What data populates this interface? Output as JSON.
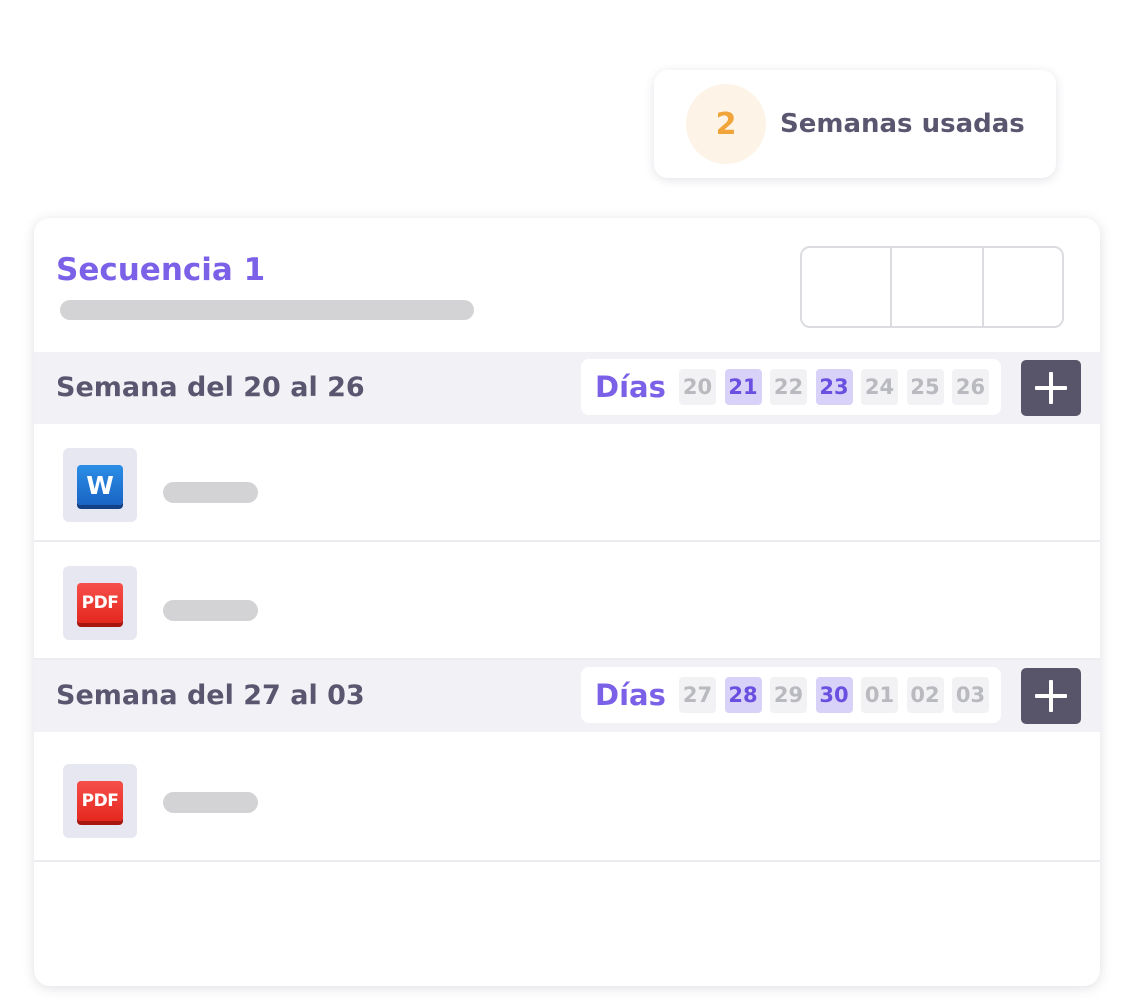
{
  "weeks_badge": {
    "count": "2",
    "label": "Semanas usadas",
    "count_color": "#f0a43a"
  },
  "sequence": {
    "title": "Secuencia 1",
    "accent_color": "#7b61e8"
  },
  "weeks": [
    {
      "title": "Semana del 20 al 26",
      "days_label": "Días",
      "days": [
        {
          "label": "20",
          "active": false
        },
        {
          "label": "21",
          "active": true
        },
        {
          "label": "22",
          "active": false
        },
        {
          "label": "23",
          "active": true
        },
        {
          "label": "24",
          "active": false
        },
        {
          "label": "25",
          "active": false
        },
        {
          "label": "26",
          "active": false
        }
      ],
      "add_icon": "plus-icon",
      "files": [
        {
          "type": "word",
          "icon": "word-file-icon",
          "icon_text": "W"
        },
        {
          "type": "pdf",
          "icon": "pdf-file-icon",
          "icon_text": "PDF"
        }
      ]
    },
    {
      "title": "Semana del 27 al 03",
      "days_label": "Días",
      "days": [
        {
          "label": "27",
          "active": false
        },
        {
          "label": "28",
          "active": true
        },
        {
          "label": "29",
          "active": false
        },
        {
          "label": "30",
          "active": true
        },
        {
          "label": "01",
          "active": false
        },
        {
          "label": "02",
          "active": false
        },
        {
          "label": "03",
          "active": false
        }
      ],
      "add_icon": "plus-icon",
      "files": [
        {
          "type": "pdf",
          "icon": "pdf-file-icon",
          "icon_text": "PDF"
        }
      ]
    }
  ]
}
